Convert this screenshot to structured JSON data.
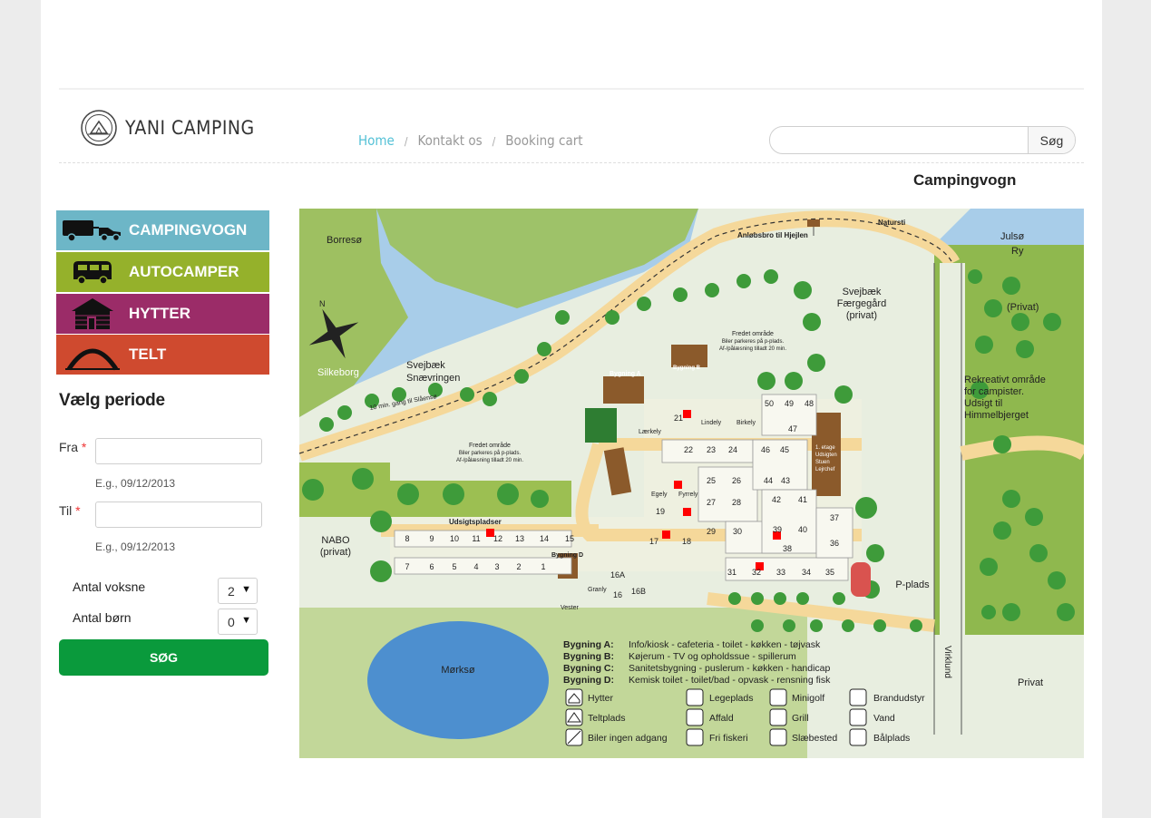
{
  "header": {
    "logo_text": "YANI CAMPING",
    "breadcrumb": [
      "Home",
      "Kontakt os",
      "Booking cart"
    ],
    "search": {
      "placeholder": "",
      "button": "Søg"
    }
  },
  "page_title": "Campingvogn",
  "sidebar": {
    "categories": [
      {
        "label": "CAMPINGVOGN",
        "icon": "caravan-icon",
        "color": "#6db6c7"
      },
      {
        "label": "AUTOCAMPER",
        "icon": "motorhome-icon",
        "color": "#95b12b"
      },
      {
        "label": "HYTTER",
        "icon": "cabin-icon",
        "color": "#9b2c68"
      },
      {
        "label": "TELT",
        "icon": "tent-icon",
        "color": "#cf4a2f"
      }
    ],
    "form": {
      "title": "Vælg periode",
      "from_label": "Fra",
      "to_label": "Til",
      "required_mark": "*",
      "from_hint": "E.g., 09/12/2013",
      "to_hint": "E.g., 09/12/2013",
      "adults_label": "Antal voksne",
      "adults_value": "2",
      "children_label": "Antal børn",
      "children_value": "0",
      "submit": "SØG"
    }
  },
  "map": {
    "places": {
      "borreso": "Borresø",
      "naturstI": "Natursti",
      "anlobsbro": "Anløbsbro til Hjejlen",
      "julso": "Julsø",
      "ry": "Ry",
      "svejbaek_faergegaard": [
        "Svejbæk",
        "Færgegård",
        "(privat)"
      ],
      "privat_top": "(Privat)",
      "silkeborg": "Silkeborg",
      "svejbaek_snaevringen": [
        "Svejbæk",
        "Snævringen"
      ],
      "walk": "10 min. gang til Slåensø",
      "fredet1": [
        "Fredet område",
        "Biler parkeres på p-plads.",
        "Af-/pålæsning tilladt 20 min."
      ],
      "fredet2": [
        "Fredet område",
        "Biler parkeres på p-plads.",
        "Af-/pålæsning tilladt 20 min."
      ],
      "rekreativt": [
        "Rekreativt område",
        "for campister.",
        "Udsigt til",
        "Himmelbjerget"
      ],
      "nabo": [
        "NABO",
        "(privat)"
      ],
      "udsigt": "Udsigtspladser",
      "morkso": "Mørksø",
      "pplads": "P-plads",
      "virklund": "Virklund",
      "privat": "Privat",
      "bygning_a": "Bygning A",
      "bygning_b": "Bygning B",
      "bygning_c": "Bygning C",
      "bygning_d": "Bygning D",
      "etage": [
        "1. etage",
        "Udsigten",
        "Stuen",
        "Lejrchef"
      ],
      "cabins": [
        "Lindely",
        "Birkely",
        "Lærkely",
        "Egely",
        "Fyrrely",
        "Granly",
        "Vester"
      ]
    },
    "pitches": [
      "50",
      "49",
      "48",
      "47",
      "46",
      "45",
      "44",
      "43",
      "42",
      "41",
      "40",
      "39",
      "38",
      "37",
      "36",
      "35",
      "34",
      "33",
      "32",
      "31",
      "30",
      "29",
      "28",
      "27",
      "26",
      "25",
      "24",
      "23",
      "22",
      "21",
      "19",
      "18",
      "17",
      "16",
      "16A",
      "16B",
      "15",
      "14",
      "13",
      "12",
      "11",
      "10",
      "9",
      "8",
      "7",
      "6",
      "5",
      "4",
      "3",
      "2",
      "1"
    ],
    "legend_buildings": [
      {
        "name": "Bygning A:",
        "desc": "Info/kiosk - cafeteria - toilet - køkken - tøjvask"
      },
      {
        "name": "Bygning B:",
        "desc": "Køjerum - TV og opholdssue - spillerum"
      },
      {
        "name": "Bygning C:",
        "desc": "Sanitetsbygning - puslerum - køkken - handicap"
      },
      {
        "name": "Bygning D:",
        "desc": "Kemisk toilet - toilet/bad - opvask - rensning fisk"
      }
    ],
    "legend_icons": [
      "Hytter",
      "Teltplads",
      "Biler ingen adgang",
      "Legeplads",
      "Affald",
      "Fri fiskeri",
      "Minigolf",
      "Grill",
      "Slæbested",
      "Brandudstyr",
      "Vand",
      "Bålplads"
    ]
  }
}
